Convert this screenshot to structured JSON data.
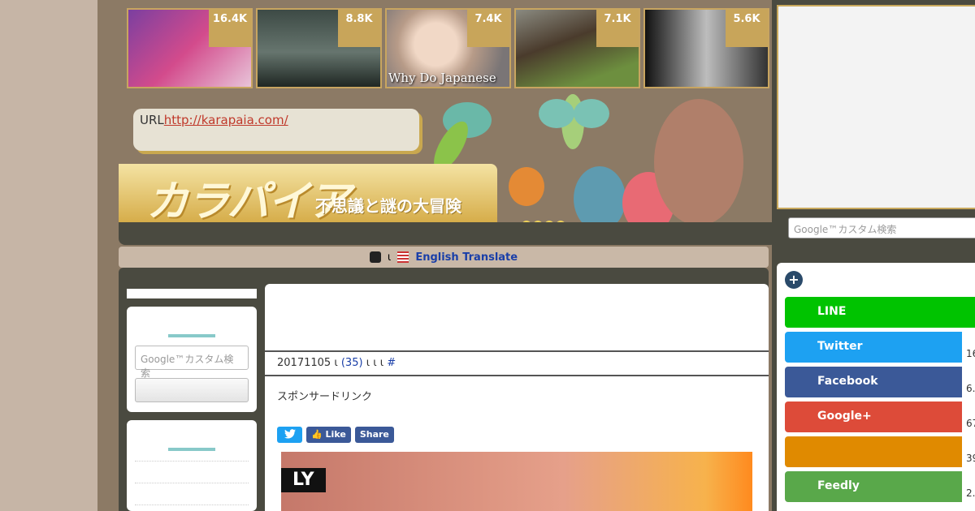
{
  "thumbnails": [
    {
      "count": "16.4K",
      "caption": "",
      "colors": [
        "#6b3b8e",
        "#cc4a8a",
        "#e3c1d8"
      ]
    },
    {
      "count": "8.8K",
      "caption": "",
      "colors": [
        "#2f3a36",
        "#5b6a63",
        "#1f2723"
      ]
    },
    {
      "count": "7.4K",
      "caption": "Why Do Japanese",
      "colors": [
        "#e7c9b4",
        "#b89a86",
        "#6d6a6a"
      ]
    },
    {
      "count": "7.1K",
      "caption": "",
      "colors": [
        "#4a3b2c",
        "#6d8f3f",
        "#2a2a20"
      ]
    },
    {
      "count": "5.6K",
      "caption": "",
      "colors": [
        "#111111",
        "#cfcfcf",
        "#444444"
      ]
    }
  ],
  "header": {
    "url_label": "URL",
    "url_link": "http://karapaia.com/",
    "logo_text": "カラパイア",
    "logo_sub": "不思議と謎の大冒険"
  },
  "translate": {
    "sep": "ι",
    "label": "English Translate"
  },
  "sidebar": {
    "search_placeholder": "Google™カスタム検索"
  },
  "article": {
    "title": "",
    "meta_date": "20171105",
    "meta_sep": "ι",
    "meta_comments": "(35)",
    "meta_tail": "ι ι ι",
    "meta_hash": "#",
    "sponsor": "スポンサードリンク",
    "video_tag": "LY",
    "share": {
      "like": "Like",
      "share": "Share"
    }
  },
  "right": {
    "search_placeholder": "Google™カスタム検索",
    "buttons": [
      {
        "label": "LINE",
        "count": "",
        "color": "#00c300"
      },
      {
        "label": "Twitter",
        "count": "16",
        "color": "#1da1f2"
      },
      {
        "label": "Facebook",
        "count": "6.",
        "color": "#3b5998"
      },
      {
        "label": "Google+",
        "count": "67",
        "color": "#dd4b39"
      },
      {
        "label": "",
        "count": "39",
        "color": "#e08a00"
      },
      {
        "label": "Feedly",
        "count": "2.",
        "color": "#59a84a"
      }
    ]
  }
}
